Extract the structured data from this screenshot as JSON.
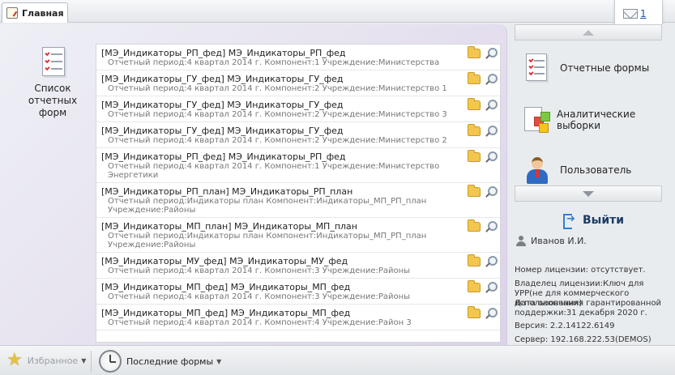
{
  "tabs": [
    {
      "label": "Главная"
    }
  ],
  "notifications": {
    "count": "1"
  },
  "main": {
    "tile_label": "Список отчетных форм",
    "forms": [
      {
        "title": "[МЭ_Индикаторы_РП_фед] МЭ_Индикаторы_РП_фед",
        "meta": "Отчетный период:4 квартал 2014 г. Компонент:1 Учреждение:Министерства"
      },
      {
        "title": "[МЭ_Индикаторы_ГУ_фед] МЭ_Индикаторы_ГУ_фед",
        "meta": "Отчетный период:4 квартал 2014 г. Компонент:2 Учреждение:Министерство 1"
      },
      {
        "title": "[МЭ_Индикаторы_ГУ_фед] МЭ_Индикаторы_ГУ_фед",
        "meta": "Отчетный период:4 квартал 2014 г. Компонент:2 Учреждение:Министерство 3"
      },
      {
        "title": "[МЭ_Индикаторы_ГУ_фед] МЭ_Индикаторы_ГУ_фед",
        "meta": "Отчетный период:4 квартал 2014 г. Компонент:2 Учреждение:Министерство 2"
      },
      {
        "title": "[МЭ_Индикаторы_РП_фед] МЭ_Индикаторы_РП_фед",
        "meta": "Отчетный период:4 квартал 2014 г. Компонент:1 Учреждение:Министерство Энергетики"
      },
      {
        "title": "[МЭ_Индикаторы_РП_план] МЭ_Индикаторы_РП_план",
        "meta": "Отчетный период:Индикаторы план Компонент:Индикаторы_МП_РП_план Учреждение:Районы"
      },
      {
        "title": "[МЭ_Индикаторы_МП_план] МЭ_Индикаторы_МП_план",
        "meta": "Отчетный период:Индикаторы план Компонент:Индикаторы_МП_РП_план Учреждение:Районы"
      },
      {
        "title": "[МЭ_Индикаторы_МУ_фед] МЭ_Индикаторы_МУ_фед",
        "meta": "Отчетный период:4 квартал 2014 г. Компонент:3 Учреждение:Районы"
      },
      {
        "title": "[МЭ_Индикаторы_МП_фед] МЭ_Индикаторы_МП_фед",
        "meta": "Отчетный период:4 квартал 2014 г. Компонент:3 Учреждение:Районы"
      },
      {
        "title": "[МЭ_Индикаторы_МП_фед] МЭ_Индикаторы_МП_фед",
        "meta": "Отчетный период:4 квартал 2014 г. Компонент:4 Учреждение:Район 3"
      }
    ]
  },
  "sidebar": {
    "items": [
      {
        "label": "Отчетные формы"
      },
      {
        "label": "Аналитические выборки"
      },
      {
        "label": "Пользователь"
      }
    ],
    "exit_label": "Выйти",
    "user_name": "Иванов И.И.",
    "license_number": "Номер лицензии: отсутствует.",
    "license_owner": "Владелец лицензии:Ключ для УРР(не для коммерческого использования)",
    "support_end": "Дата окончания гарантированной поддержки:31 декабря 2020 г.",
    "version": "Версия: 2.2.14122.6149",
    "server": "Сервер: 192.168.222.53(DEMOS)"
  },
  "bottombar": {
    "favorites_label": "Избранное",
    "recent_label": "Последние формы"
  },
  "colors": {
    "accent_link": "#1a56b0",
    "panel_purple": "#dcd2ea",
    "folder": "#f3c64f"
  }
}
